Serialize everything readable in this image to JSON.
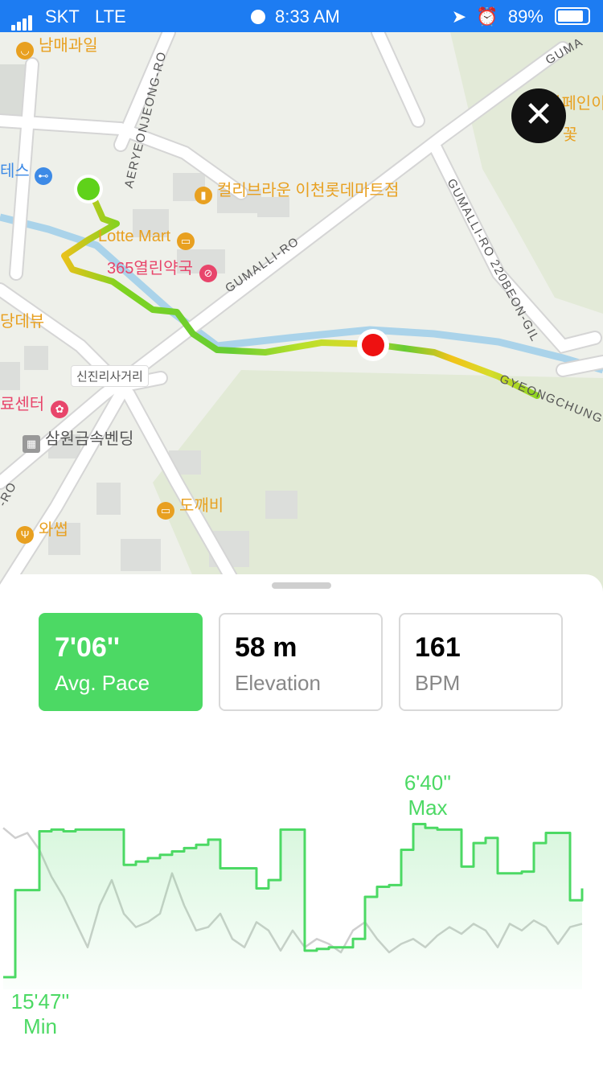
{
  "status_bar": {
    "carrier": "SKT",
    "network": "LTE",
    "time": "8:33 AM",
    "battery": "89%"
  },
  "map": {
    "pois": [
      {
        "label": "남매과일",
        "color": "#e8a020",
        "icon": "basket-icon"
      },
      {
        "label": "테스",
        "color": "#3d8ae6",
        "icon": "dumbbell-icon"
      },
      {
        "label": "컬리브라운 이천롯데마트점",
        "color": "#e8a020",
        "icon": "cup-icon"
      },
      {
        "label": "Lotte Mart",
        "color": "#e8a020",
        "icon": "bag-icon"
      },
      {
        "label": "365열린약국",
        "color": "#e8456b",
        "icon": "pill-icon"
      },
      {
        "label": "당데뷰",
        "color": "#e8a020",
        "icon": ""
      },
      {
        "label": "료센터",
        "color": "#e8456b",
        "icon": "paw-icon"
      },
      {
        "label": "삼원금속벤딩",
        "color": "#777777",
        "icon": "building-icon"
      },
      {
        "label": "도깨비",
        "color": "#e8a020",
        "icon": "bag-icon"
      },
      {
        "label": "와썹",
        "color": "#e8a020",
        "icon": "fork-knife-icon"
      },
      {
        "label": "카페인이",
        "color": "#e8a020",
        "icon": ""
      },
      {
        "label": "꽃",
        "color": "#e8a020",
        "icon": "flower-icon"
      }
    ],
    "roads": {
      "aeryeonjeong": "AERYEONJEONG-RO",
      "gumalli": "GUMALLI-RO",
      "gumalli_top": "GUMA",
      "gumalli_220": "GUMALLI-RO 220BEON-GIL",
      "gyeongchung": "GYEONGCHUNG",
      "ro_left": "-RO",
      "intersection": "신진리사거리"
    }
  },
  "stats": [
    {
      "value": "7'06''",
      "label": "Avg. Pace",
      "active": true
    },
    {
      "value": "58 m",
      "label": "Elevation",
      "active": false
    },
    {
      "value": "161",
      "label": "BPM",
      "active": false
    }
  ],
  "chart_data": {
    "type": "line",
    "series": [
      {
        "name": "",
        "color": "#4cd964",
        "values": [
          15.78,
          10.6,
          10.6,
          7.1,
          7.0,
          7.1,
          7.0,
          7.0,
          7.0,
          7.0,
          9.1,
          8.9,
          8.7,
          8.5,
          8.3,
          8.1,
          7.9,
          7.6,
          9.3,
          9.3,
          9.3,
          10.5,
          10.0,
          7.0,
          7.0,
          14.2,
          14.1,
          14.0,
          14.0,
          13.5,
          11.0,
          10.4,
          10.3,
          8.2,
          6.67,
          6.9,
          7.0,
          7.0,
          9.2,
          7.8,
          7.5,
          9.6,
          9.6,
          9.5,
          7.8,
          7.2,
          7.2,
          11.2,
          10.5
        ]
      },
      {
        "name": "",
        "color": "#cfcfcf",
        "values": [
          6.9,
          7.5,
          7.2,
          8.2,
          9.8,
          11.0,
          12.5,
          14.0,
          11.5,
          10.0,
          12.0,
          12.8,
          12.5,
          12.0,
          9.6,
          11.5,
          13.0,
          12.8,
          12.0,
          13.5,
          14.0,
          12.5,
          13.0,
          14.2,
          13.0,
          14.0,
          13.5,
          13.8,
          14.3,
          13.0,
          12.5,
          13.5,
          14.3,
          13.8,
          13.5,
          14.0,
          13.3,
          12.8,
          13.2,
          12.6,
          13.0,
          14.0,
          12.6,
          13.0,
          12.4,
          12.8,
          13.8,
          12.8,
          12.6
        ]
      }
    ],
    "ylim": [
      5.5,
      16.5
    ],
    "annotations": {
      "max_value": "6'40''",
      "max_label": "Max",
      "min_value": "15'47''",
      "min_label": "Min"
    }
  }
}
